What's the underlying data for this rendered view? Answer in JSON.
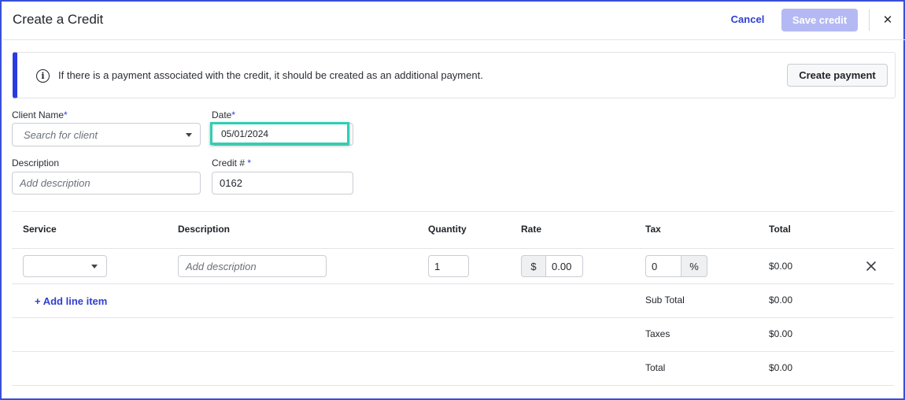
{
  "header": {
    "title": "Create a Credit",
    "cancel_label": "Cancel",
    "save_label": "Save credit",
    "close_glyph": "✕"
  },
  "notice": {
    "icon": "info-icon",
    "text": "If there is a payment associated with the credit, it should be created as an additional payment.",
    "button_label": "Create payment"
  },
  "form": {
    "client": {
      "label": "Client Name",
      "required_mark": "*",
      "placeholder": "Search for client",
      "value": ""
    },
    "date": {
      "label": "Date",
      "required_mark": "*",
      "value": "05/01/2024"
    },
    "description": {
      "label": "Description",
      "placeholder": "Add description",
      "value": ""
    },
    "credit_number": {
      "label": "Credit # ",
      "required_mark": "*",
      "value": "0162"
    }
  },
  "table": {
    "columns": [
      "Service",
      "Description",
      "Quantity",
      "Rate",
      "Tax",
      "Total"
    ],
    "row": {
      "service": "",
      "description_placeholder": "Add description",
      "quantity": "1",
      "rate_prefix": "$",
      "rate": "0.00",
      "tax": "0",
      "tax_suffix": "%",
      "total": "$0.00"
    },
    "add_line_label": "+ Add line item",
    "summary": [
      {
        "label": "Sub Total",
        "value": "$0.00"
      },
      {
        "label": "Taxes",
        "value": "$0.00"
      },
      {
        "label": "Total",
        "value": "$0.00"
      }
    ]
  },
  "colors": {
    "accent": "#2f3fd0",
    "save_disabled": "#b4b9f4",
    "focus_highlight": "#2fcfb5",
    "frame_border": "#3a4fd8"
  }
}
